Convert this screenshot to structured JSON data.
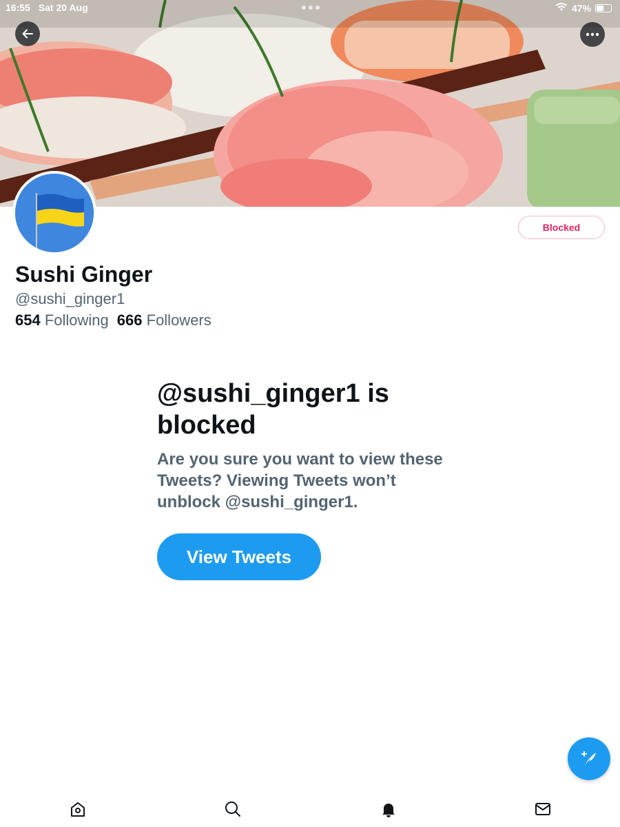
{
  "status_bar": {
    "time": "16:55",
    "date": "Sat 20 Aug",
    "battery": "47%",
    "battery_level": 0.47,
    "wifi_icon": "wifi-icon"
  },
  "header": {
    "back_icon": "arrow-left-icon",
    "more_icon": "more-horizontal-icon"
  },
  "profile": {
    "avatar_description": "ukraine-flag-avatar",
    "display_name": "Sushi Ginger",
    "handle": "@sushi_ginger1",
    "following_count": "654",
    "following_label": "Following",
    "followers_count": "666",
    "followers_label": "Followers",
    "blocked_button_label": "Blocked"
  },
  "blocked_notice": {
    "title": "@sushi_ginger1 is blocked",
    "description": "Are you sure you want to view these Tweets? Viewing Tweets won’t unblock @sushi_ginger1.",
    "button_label": "View Tweets"
  },
  "compose": {
    "icon": "compose-feather-icon"
  },
  "tab_bar": {
    "items": [
      "home-icon",
      "search-icon",
      "notifications-icon",
      "messages-icon"
    ]
  },
  "colors": {
    "accent": "#1d9bf0",
    "blocked_red": "#e0245e",
    "secondary_text": "#536471",
    "primary_text": "#0f1419"
  }
}
